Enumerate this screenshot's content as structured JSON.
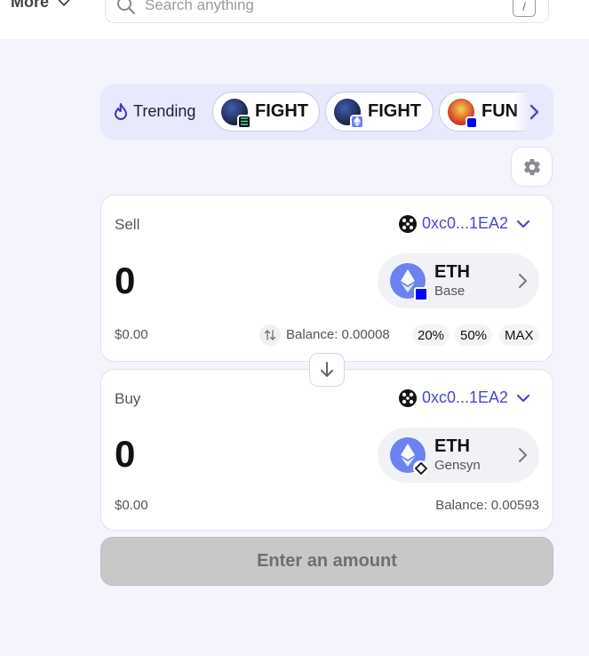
{
  "topbar": {
    "more_label": "More",
    "search_placeholder": "Search anything",
    "search_shortcut": "/"
  },
  "trending": {
    "label": "Trending",
    "items": [
      {
        "label": "FIGHT",
        "icon": "fight-token-icon",
        "chain_badge": "solana-badge"
      },
      {
        "label": "FIGHT",
        "icon": "fight-token-icon",
        "chain_badge": "ethereum-badge"
      },
      {
        "label": "FUN",
        "icon": "fun-token-icon",
        "chain_badge": "base-badge"
      }
    ]
  },
  "sell": {
    "title": "Sell",
    "wallet": "0xc0...1EA2",
    "amount": "0",
    "token_symbol": "ETH",
    "token_network": "Base",
    "usd_value": "$0.00",
    "balance": "Balance: 0.00008",
    "percent_options": [
      "20%",
      "50%",
      "MAX"
    ]
  },
  "buy": {
    "title": "Buy",
    "wallet": "0xc0...1EA2",
    "amount": "0",
    "token_symbol": "ETH",
    "token_network": "Gensyn",
    "usd_value": "$0.00",
    "balance": "Balance: 0.00593"
  },
  "cta_label": "Enter an amount",
  "colors": {
    "accent": "#4b47d6",
    "background": "#f3f4fc",
    "trending_bg": "#e8e9fb",
    "eth_blue": "#6b82f0",
    "disabled_button": "#c8c8c8"
  }
}
